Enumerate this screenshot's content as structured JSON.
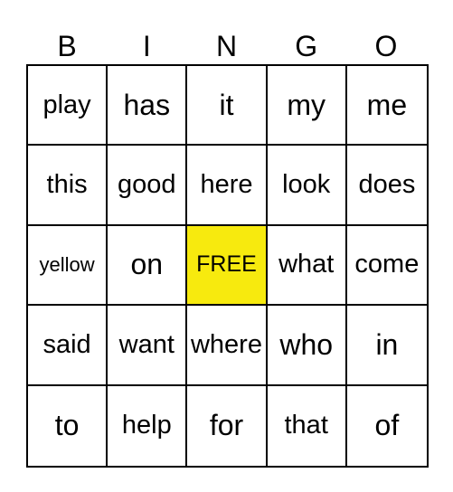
{
  "header": [
    "B",
    "I",
    "N",
    "G",
    "O"
  ],
  "free_color": "#f7ea0e",
  "rows": [
    [
      "play",
      "has",
      "it",
      "my",
      "me"
    ],
    [
      "this",
      "good",
      "here",
      "look",
      "does"
    ],
    [
      "yellow",
      "on",
      "FREE",
      "what",
      "come"
    ],
    [
      "said",
      "want",
      "where",
      "who",
      "in"
    ],
    [
      "to",
      "help",
      "for",
      "that",
      "of"
    ]
  ]
}
